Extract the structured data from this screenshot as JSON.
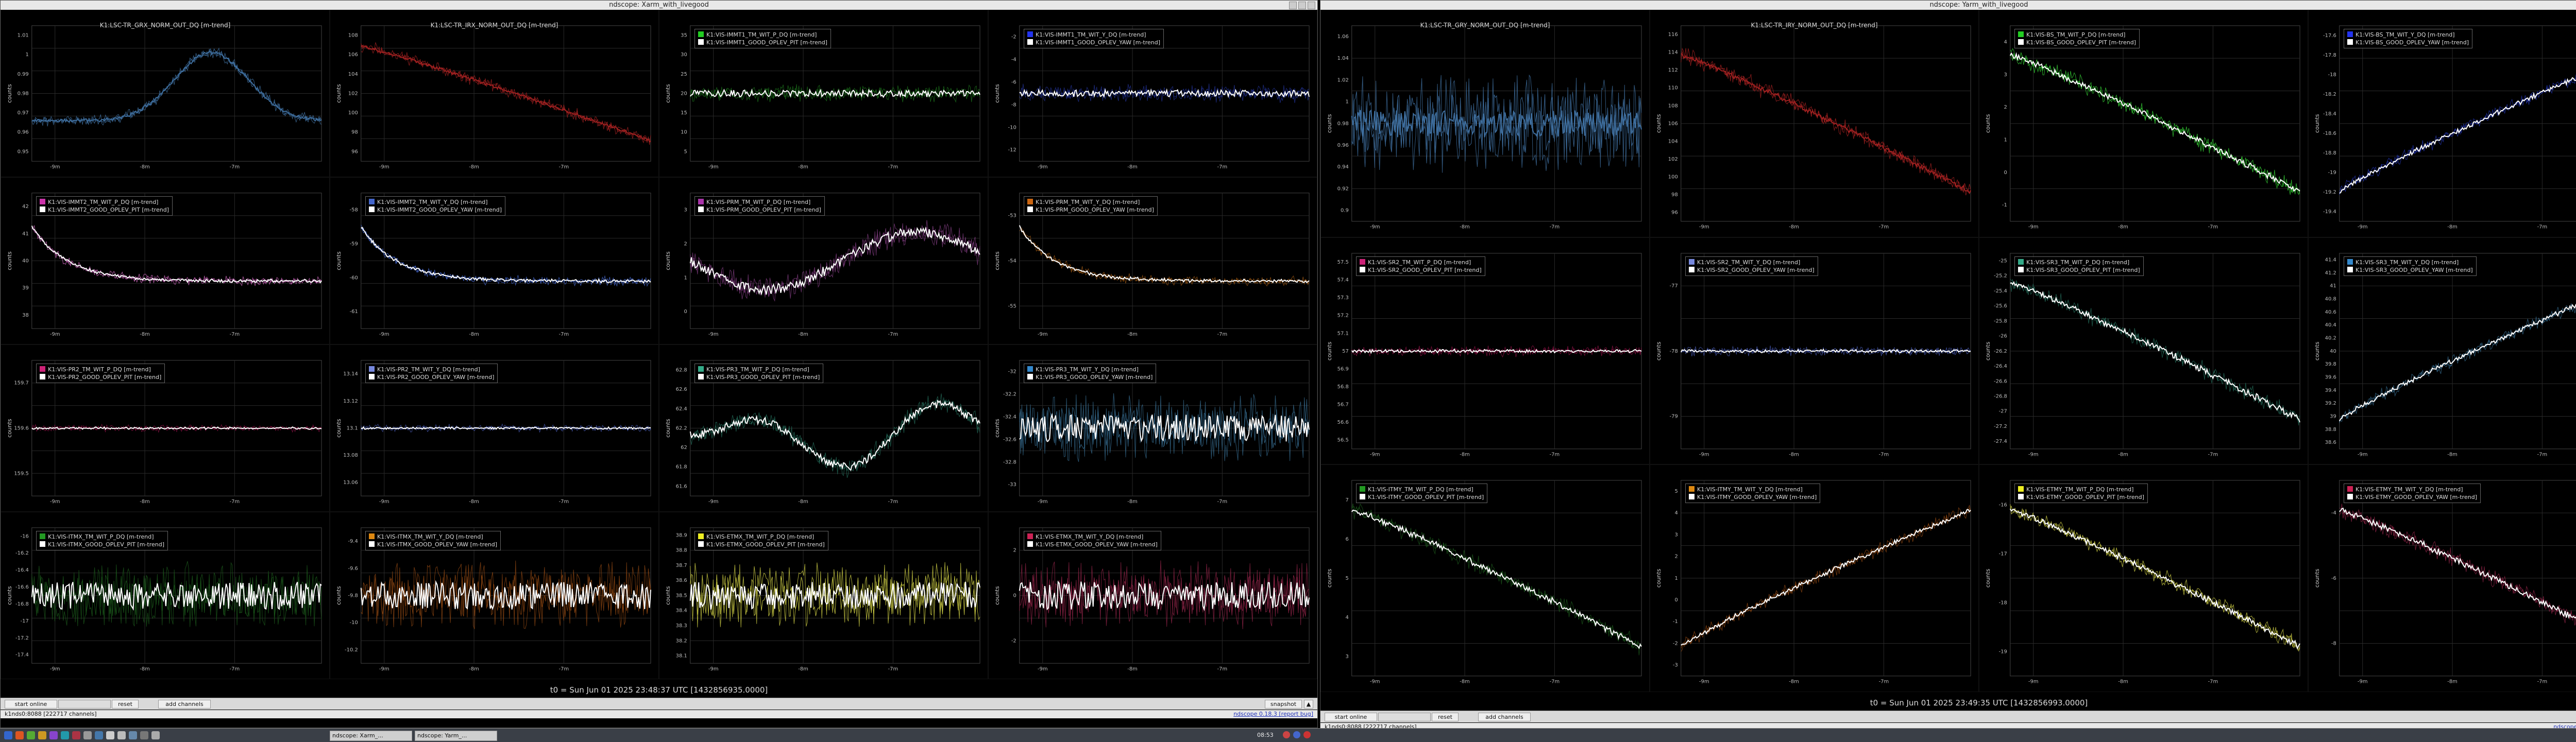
{
  "windows": [
    {
      "title": "ndscope: Xarm_with_livegood",
      "t0": "t0 = Sun Jun 01 2025 23:48:37 UTC [1432856935.0000]",
      "xticks": [
        "-9m",
        "-8m",
        "-7m"
      ],
      "buttons": {
        "start": "start online",
        "reset": "reset",
        "add": "add channels",
        "snapshot": "snapshot"
      },
      "status_left": "k1nds0:8088 [222717 channels]",
      "status_right": "ndscope 0.18.3 [report bug]",
      "rows": [
        [
          {
            "title": "K1:LSC-TR_GRX_NORM_OUT_DQ [m-trend]",
            "legend": [],
            "yticks": [
              "1.01",
              "1",
              "0.99",
              "0.98",
              "0.97",
              "0.96",
              "0.95"
            ],
            "colors": [
              "#3e6e9e"
            ],
            "shape": "hump",
            "white": false
          },
          {
            "title": "K1:LSC-TR_IRX_NORM_OUT_DQ [m-trend]",
            "legend": [],
            "yticks": [
              "108",
              "106",
              "104",
              "102",
              "100",
              "98",
              "96"
            ],
            "colors": [
              "#a02020"
            ],
            "shape": "fall",
            "white": false
          },
          {
            "title": "",
            "legend": [
              {
                "c": "#22cc22",
                "t": "K1:VIS-IMMT1_TM_WIT_P_DQ [m-trend]"
              },
              {
                "c": "#ffffff",
                "t": "K1:VIS-IMMT1_GOOD_OPLEV_PIT [m-trend]"
              }
            ],
            "yticks": [
              "35",
              "30",
              "25",
              "20",
              "15",
              "10",
              "5"
            ],
            "colors": [
              "#1a6e1a"
            ],
            "shape": "flatnoise",
            "white": true
          },
          {
            "title": "",
            "legend": [
              {
                "c": "#2233ee",
                "t": "K1:VIS-IMMT1_TM_WIT_Y_DQ [m-trend]"
              },
              {
                "c": "#ffffff",
                "t": "K1:VIS-IMMT1_GOOD_OPLEV_YAW [m-trend]"
              }
            ],
            "yticks": [
              "-2",
              "-4",
              "-6",
              "-8",
              "-10",
              "-12"
            ],
            "colors": [
              "#20308e"
            ],
            "shape": "flatnoise",
            "white": true
          }
        ],
        [
          {
            "title": "",
            "legend": [
              {
                "c": "#cc33aa",
                "t": "K1:VIS-IMMT2_TM_WIT_P_DQ [m-trend]"
              },
              {
                "c": "#ffffff",
                "t": "K1:VIS-IMMT2_GOOD_OPLEV_PIT [m-trend]"
              }
            ],
            "yticks": [
              "42",
              "41",
              "40",
              "39",
              "38"
            ],
            "colors": [
              "#cc66bb"
            ],
            "shape": "decay",
            "white": true
          },
          {
            "title": "",
            "legend": [
              {
                "c": "#4466cc",
                "t": "K1:VIS-IMMT2_TM_WIT_Y_DQ [m-trend]"
              },
              {
                "c": "#ffffff",
                "t": "K1:VIS-IMMT2_GOOD_OPLEV_YAW [m-trend]"
              }
            ],
            "yticks": [
              "-58",
              "-59",
              "-60",
              "-61"
            ],
            "colors": [
              "#4466cc"
            ],
            "shape": "decay",
            "white": true
          },
          {
            "title": "",
            "legend": [
              {
                "c": "#aa33aa",
                "t": "K1:VIS-PRM_TM_WIT_P_DQ [m-trend]"
              },
              {
                "c": "#ffffff",
                "t": "K1:VIS-PRM_GOOD_OPLEV_PIT [m-trend]"
              }
            ],
            "yticks": [
              "3",
              "2",
              "1",
              "0"
            ],
            "colors": [
              "#7a3a7a"
            ],
            "shape": "dipnoise",
            "white": true
          },
          {
            "title": "",
            "legend": [
              {
                "c": "#cc6611",
                "t": "K1:VIS-PRM_TM_WIT_Y_DQ [m-trend]"
              },
              {
                "c": "#ffffff",
                "t": "K1:VIS-PRM_GOOD_OPLEV_YAW [m-trend]"
              }
            ],
            "yticks": [
              "-53",
              "-54",
              "-55"
            ],
            "colors": [
              "#995511"
            ],
            "shape": "decay",
            "white": true
          }
        ],
        [
          {
            "title": "",
            "legend": [
              {
                "c": "#cc2277",
                "t": "K1:VIS-PR2_TM_WIT_P_DQ [m-trend]"
              },
              {
                "c": "#ffffff",
                "t": "K1:VIS-PR2_GOOD_OPLEV_PIT [m-trend]"
              }
            ],
            "yticks": [
              "159.7",
              "159.6",
              "159.5"
            ],
            "colors": [
              "#881144"
            ],
            "shape": "flatband",
            "white": true
          },
          {
            "title": "",
            "legend": [
              {
                "c": "#7788dd",
                "t": "K1:VIS-PR2_TM_WIT_Y_DQ [m-trend]"
              },
              {
                "c": "#ffffff",
                "t": "K1:VIS-PR2_GOOD_OPLEV_YAW [m-trend]"
              }
            ],
            "yticks": [
              "13.14",
              "13.12",
              "13.1",
              "13.08",
              "13.06"
            ],
            "colors": [
              "#4455aa"
            ],
            "shape": "flatband",
            "white": true
          },
          {
            "title": "",
            "legend": [
              {
                "c": "#33aa88",
                "t": "K1:VIS-PR3_TM_WIT_P_DQ [m-trend]"
              },
              {
                "c": "#ffffff",
                "t": "K1:VIS-PR3_GOOD_OPLEV_PIT [m-trend]"
              }
            ],
            "yticks": [
              "62.8",
              "62.6",
              "62.4",
              "62.2",
              "62",
              "61.8",
              "61.6"
            ],
            "colors": [
              "#226655"
            ],
            "shape": "wave",
            "white": true
          },
          {
            "title": "",
            "legend": [
              {
                "c": "#3388cc",
                "t": "K1:VIS-PR3_TM_WIT_Y_DQ [m-trend]"
              },
              {
                "c": "#ffffff",
                "t": "K1:VIS-PR3_GOOD_OPLEV_YAW [m-trend]"
              }
            ],
            "yticks": [
              "-32",
              "-32.2",
              "-32.4",
              "-32.6",
              "-32.8",
              "-33"
            ],
            "colors": [
              "#336688"
            ],
            "shape": "heavynoise",
            "white": true
          }
        ],
        [
          {
            "title": "",
            "legend": [
              {
                "c": "#229922",
                "t": "K1:VIS-ITMX_TM_WIT_P_DQ [m-trend]"
              },
              {
                "c": "#ffffff",
                "t": "K1:VIS-ITMX_GOOD_OPLEV_PIT [m-trend]"
              }
            ],
            "yticks": [
              "-16",
              "-16.2",
              "-16.4",
              "-16.6",
              "-16.8",
              "-17",
              "-17.2",
              "-17.4"
            ],
            "colors": [
              "#1a551a"
            ],
            "shape": "heavynoise",
            "white": true
          },
          {
            "title": "",
            "legend": [
              {
                "c": "#dd8811",
                "t": "K1:VIS-ITMX_TM_WIT_Y_DQ [m-trend]"
              },
              {
                "c": "#ffffff",
                "t": "K1:VIS-ITMX_GOOD_OPLEV_YAW [m-trend]"
              }
            ],
            "yticks": [
              "-9.4",
              "-9.6",
              "-9.8",
              "-10",
              "-10.2"
            ],
            "colors": [
              "#884411"
            ],
            "shape": "heavynoise",
            "white": true
          },
          {
            "title": "",
            "legend": [
              {
                "c": "#eeee22",
                "t": "K1:VIS-ETMX_TM_WIT_P_DQ [m-trend]"
              },
              {
                "c": "#ffffff",
                "t": "K1:VIS-ETMX_GOOD_OPLEV_PIT [m-trend]"
              }
            ],
            "yticks": [
              "38.9",
              "38.8",
              "38.7",
              "38.6",
              "38.5",
              "38.4",
              "38.3",
              "38.2",
              "38.1"
            ],
            "colors": [
              "#cccc44"
            ],
            "shape": "heavynoise",
            "white": true
          },
          {
            "title": "",
            "legend": [
              {
                "c": "#cc2255",
                "t": "K1:VIS-ETMX_TM_WIT_Y_DQ [m-trend]"
              },
              {
                "c": "#ffffff",
                "t": "K1:VIS-ETMX_GOOD_OPLEV_YAW [m-trend]"
              }
            ],
            "yticks": [
              "2",
              "0",
              "-2"
            ],
            "colors": [
              "#882244"
            ],
            "shape": "heavynoise",
            "white": true
          }
        ]
      ]
    },
    {
      "title": "ndscope: Yarm_with_livegood",
      "t0": "t0 = Sun Jun 01 2025 23:49:35 UTC [1432856993.0000]",
      "xticks": [
        "-9m",
        "-8m",
        "-7m"
      ],
      "buttons": {
        "start": "start online",
        "reset": "reset",
        "add": "add channels",
        "snapshot": "snapshot"
      },
      "status_left": "k1nds0:8088 [222717 channels]",
      "status_right": "ndscope 0.18.3 [report bug]",
      "rows": [
        [
          {
            "title": "K1:LSC-TR_GRY_NORM_OUT_DQ [m-trend]",
            "legend": [],
            "yticks": [
              "1.06",
              "1.04",
              "1.02",
              "1",
              "0.98",
              "0.96",
              "0.94",
              "0.92",
              "0.9"
            ],
            "colors": [
              "#3e6e9e"
            ],
            "shape": "heavynoise",
            "white": false
          },
          {
            "title": "K1:LSC-TR_IRY_NORM_OUT_DQ [m-trend]",
            "legend": [],
            "yticks": [
              "116",
              "114",
              "112",
              "110",
              "108",
              "106",
              "104",
              "102",
              "100",
              "98",
              "96"
            ],
            "colors": [
              "#a02020"
            ],
            "shape": "fall",
            "white": false
          },
          {
            "title": "",
            "legend": [
              {
                "c": "#22cc22",
                "t": "K1:VIS-BS_TM_WIT_P_DQ [m-trend]"
              },
              {
                "c": "#ffffff",
                "t": "K1:VIS-BS_GOOD_OPLEV_PIT [m-trend]"
              }
            ],
            "yticks": [
              "4",
              "3",
              "2",
              "1",
              "0",
              "-1"
            ],
            "colors": [
              "#33cc33"
            ],
            "shape": "fall",
            "white": true
          },
          {
            "title": "",
            "legend": [
              {
                "c": "#2233ee",
                "t": "K1:VIS-BS_TM_WIT_Y_DQ [m-trend]"
              },
              {
                "c": "#ffffff",
                "t": "K1:VIS-BS_GOOD_OPLEV_YAW [m-trend]"
              }
            ],
            "yticks": [
              "-17.6",
              "-17.8",
              "-18",
              "-18.2",
              "-18.4",
              "-18.6",
              "-18.8",
              "-19",
              "-19.2",
              "-19.4"
            ],
            "colors": [
              "#2233aa"
            ],
            "shape": "rise",
            "white": true
          }
        ],
        [
          {
            "title": "",
            "legend": [
              {
                "c": "#cc2277",
                "t": "K1:VIS-SR2_TM_WIT_P_DQ [m-trend]"
              },
              {
                "c": "#ffffff",
                "t": "K1:VIS-SR2_GOOD_OPLEV_PIT [m-trend]"
              }
            ],
            "yticks": [
              "57.5",
              "57.4",
              "57.3",
              "57.2",
              "57.1",
              "57",
              "56.9",
              "56.8",
              "56.7",
              "56.6",
              "56.5"
            ],
            "colors": [
              "#881144"
            ],
            "shape": "flatband",
            "white": true
          },
          {
            "title": "",
            "legend": [
              {
                "c": "#7788dd",
                "t": "K1:VIS-SR2_TM_WIT_Y_DQ [m-trend]"
              },
              {
                "c": "#ffffff",
                "t": "K1:VIS-SR2_GOOD_OPLEV_YAW [m-trend]"
              }
            ],
            "yticks": [
              "-77",
              "-78",
              "-79"
            ],
            "colors": [
              "#4455aa"
            ],
            "shape": "flatband",
            "white": true
          },
          {
            "title": "",
            "legend": [
              {
                "c": "#33aa88",
                "t": "K1:VIS-SR3_TM_WIT_P_DQ [m-trend]"
              },
              {
                "c": "#ffffff",
                "t": "K1:VIS-SR3_GOOD_OPLEV_PIT [m-trend]"
              }
            ],
            "yticks": [
              "-25",
              "-25.2",
              "-25.4",
              "-25.6",
              "-25.8",
              "-26",
              "-26.2",
              "-26.4",
              "-26.6",
              "-26.8",
              "-27",
              "-27.2",
              "-27.4"
            ],
            "colors": [
              "#226655"
            ],
            "shape": "fall",
            "white": true
          },
          {
            "title": "",
            "legend": [
              {
                "c": "#3388cc",
                "t": "K1:VIS-SR3_TM_WIT_Y_DQ [m-trend]"
              },
              {
                "c": "#ffffff",
                "t": "K1:VIS-SR3_GOOD_OPLEV_YAW [m-trend]"
              }
            ],
            "yticks": [
              "41.4",
              "41.2",
              "41",
              "40.8",
              "40.6",
              "40.4",
              "40.2",
              "40",
              "39.8",
              "39.6",
              "39.4",
              "39.2",
              "39",
              "38.8",
              "38.6"
            ],
            "colors": [
              "#336688"
            ],
            "shape": "rise",
            "white": true
          }
        ],
        [
          {
            "title": "",
            "legend": [
              {
                "c": "#229922",
                "t": "K1:VIS-ITMY_TM_WIT_P_DQ [m-trend]"
              },
              {
                "c": "#ffffff",
                "t": "K1:VIS-ITMY_GOOD_OPLEV_PIT [m-trend]"
              }
            ],
            "yticks": [
              "7",
              "6",
              "5",
              "4",
              "3"
            ],
            "colors": [
              "#1a551a"
            ],
            "shape": "fall",
            "white": true
          },
          {
            "title": "",
            "legend": [
              {
                "c": "#dd8811",
                "t": "K1:VIS-ITMY_TM_WIT_Y_DQ [m-trend]"
              },
              {
                "c": "#ffffff",
                "t": "K1:VIS-ITMY_GOOD_OPLEV_YAW [m-trend]"
              }
            ],
            "yticks": [
              "5",
              "4",
              "3",
              "2",
              "1",
              "0",
              "-1",
              "-2",
              "-3"
            ],
            "colors": [
              "#884411"
            ],
            "shape": "rise",
            "white": true
          },
          {
            "title": "",
            "legend": [
              {
                "c": "#eeee22",
                "t": "K1:VIS-ETMY_TM_WIT_P_DQ [m-trend]"
              },
              {
                "c": "#ffffff",
                "t": "K1:VIS-ETMY_GOOD_OPLEV_PIT [m-trend]"
              }
            ],
            "yticks": [
              "-16",
              "-17",
              "-18",
              "-19"
            ],
            "colors": [
              "#cccc44"
            ],
            "shape": "fall",
            "white": true
          },
          {
            "title": "",
            "legend": [
              {
                "c": "#cc2255",
                "t": "K1:VIS-ETMY_TM_WIT_Y_DQ [m-trend]"
              },
              {
                "c": "#ffffff",
                "t": "K1:VIS-ETMY_GOOD_OPLEV_YAW [m-trend]"
              }
            ],
            "yticks": [
              "-4",
              "-6",
              "-8"
            ],
            "colors": [
              "#882244"
            ],
            "shape": "fall",
            "white": true
          }
        ]
      ]
    }
  ],
  "taskbar": {
    "items": [
      "ndscope: Xarm_...",
      "ndscope: Yarm_..."
    ],
    "clock": "08:53"
  }
}
